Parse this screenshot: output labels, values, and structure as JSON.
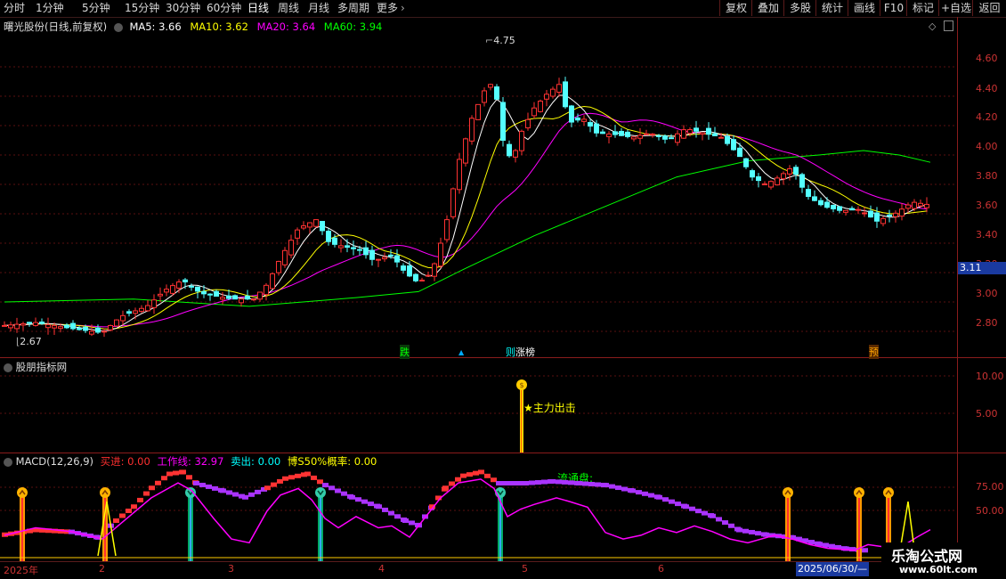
{
  "toolbar": {
    "periods": [
      "分时",
      "1分钟",
      "5分钟",
      "15分钟",
      "30分钟",
      "60分钟",
      "日线",
      "周线",
      "月线",
      "多周期",
      "更多"
    ],
    "active_period": "日线",
    "buttons": [
      "复权",
      "叠加",
      "多股",
      "统计",
      "画线",
      "F10",
      "标记",
      "+自选",
      "返回"
    ]
  },
  "main_panel": {
    "title": "曙光股份(日线,前复权)",
    "ma_labels": [
      {
        "text": "MA5: 3.66",
        "color": "#ffffff"
      },
      {
        "text": "MA10: 3.62",
        "color": "#ffff00"
      },
      {
        "text": "MA20: 3.64",
        "color": "#ff00ff"
      },
      {
        "text": "MA60: 3.94",
        "color": "#00ff00"
      }
    ],
    "y_ticks": [
      "4.60",
      "4.40",
      "4.20",
      "4.00",
      "3.80",
      "3.60",
      "3.40",
      "3.20",
      "3.00",
      "2.80"
    ],
    "current_price_tag": "3.11",
    "high_label": "4.75",
    "low_label": "2.67",
    "signal_tags": [
      {
        "text": "跌",
        "color": "#00ff00"
      },
      {
        "text": "▲",
        "color": "#00a0ff"
      },
      {
        "text": "则",
        "color": "#00ffff"
      },
      {
        "text": "涨榜",
        "color": "#ffffff"
      },
      {
        "text": "预",
        "color": "#ffaa00"
      }
    ]
  },
  "indicator_panel": {
    "title": "股朋指标网",
    "y_ticks": [
      "10.00",
      "5.00"
    ],
    "signal_text": "★主力出击"
  },
  "macd_panel": {
    "title": "MACD(12,26,9)",
    "labels": [
      {
        "text": "买进: 0.00",
        "color": "#ff3030"
      },
      {
        "text": "工作线: 32.97",
        "color": "#ff00ff"
      },
      {
        "text": "卖出: 0.00",
        "color": "#00ffff"
      },
      {
        "text": "博S50%概率: 0.00",
        "color": "#ffff00"
      }
    ],
    "y_ticks": [
      "75.00",
      "50.00"
    ],
    "float_label": "流通盘:"
  },
  "date_axis": {
    "labels": [
      "2025年",
      "2",
      "3",
      "4",
      "5",
      "6"
    ],
    "cursor_date": "2025/06/30/—"
  },
  "watermark": {
    "title": "乐淘公式网",
    "url": "www.60lt.com"
  }
}
